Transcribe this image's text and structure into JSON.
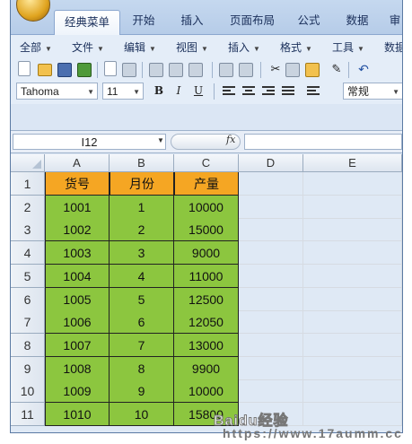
{
  "ribbon": {
    "tabs": [
      "经典菜单",
      "开始",
      "插入",
      "页面布局",
      "公式",
      "数据",
      "审"
    ],
    "active_tab": 0
  },
  "menu": {
    "items": [
      "全部",
      "文件",
      "编辑",
      "视图",
      "插入",
      "格式",
      "工具",
      "数据"
    ]
  },
  "format": {
    "font_name": "Tahoma",
    "font_size": "11",
    "bold": "B",
    "italic": "I",
    "underline": "U",
    "number_format": "常规"
  },
  "formula_bar": {
    "name_box": "I12",
    "fx": "fx",
    "formula": ""
  },
  "sheet": {
    "columns": [
      "A",
      "B",
      "C",
      "D",
      "E"
    ],
    "rows": [
      "1",
      "2",
      "3",
      "4",
      "5",
      "6",
      "7",
      "8",
      "9",
      "10",
      "11"
    ],
    "headers": [
      "货号",
      "月份",
      "产量"
    ],
    "data": [
      [
        "1001",
        "1",
        "10000"
      ],
      [
        "1002",
        "2",
        "15000"
      ],
      [
        "1003",
        "3",
        "9000"
      ],
      [
        "1004",
        "4",
        "11000"
      ],
      [
        "1005",
        "5",
        "12500"
      ],
      [
        "1006",
        "6",
        "12050"
      ],
      [
        "1007",
        "7",
        "13000"
      ],
      [
        "1008",
        "8",
        "9900"
      ],
      [
        "1009",
        "9",
        "10000"
      ],
      [
        "1010",
        "10",
        "15800"
      ]
    ]
  },
  "watermark": {
    "line1": "Baidu经验",
    "line2": "https://www.17aumm.cc"
  },
  "colors": {
    "header_fill": "#f5a623",
    "data_fill": "#8cc63f"
  }
}
